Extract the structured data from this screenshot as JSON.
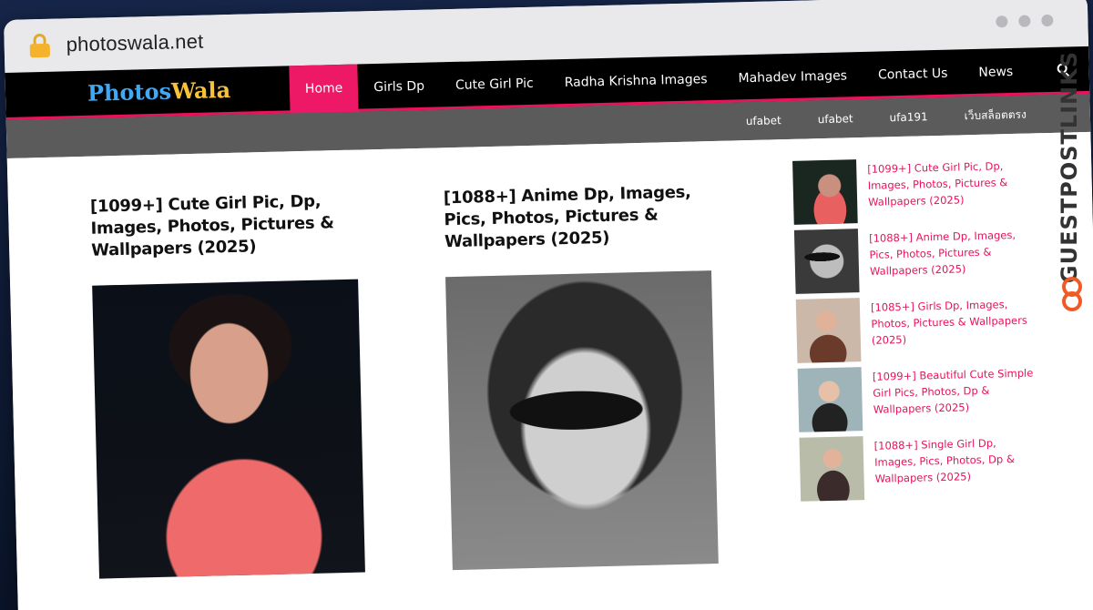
{
  "browser": {
    "url": "photoswala.net"
  },
  "site": {
    "logo": {
      "part1": "Photos",
      "part2": "Wala"
    },
    "menu": [
      {
        "label": "Home",
        "active": true
      },
      {
        "label": "Girls Dp"
      },
      {
        "label": "Cute Girl Pic"
      },
      {
        "label": "Radha Krishna Images"
      },
      {
        "label": "Mahadev Images"
      },
      {
        "label": "Contact Us"
      },
      {
        "label": "News"
      }
    ],
    "submenu": [
      "ufabet",
      "ufabet",
      "ufa191",
      "เว็บสล็อตตรง"
    ],
    "accent_color": "#e8125d"
  },
  "posts": [
    {
      "title": "[1099+] Cute Girl Pic, Dp, Images, Photos, Pictures & Wallpapers (2025)"
    },
    {
      "title": "[1088+] Anime Dp, Images, Pics, Photos, Pictures & Wallpapers (2025)"
    }
  ],
  "sidebar": [
    {
      "title": "[1099+] Cute Girl Pic, Dp, Images, Photos, Pictures & Wallpapers (2025)"
    },
    {
      "title": "[1088+] Anime Dp, Images, Pics, Photos, Pictures & Wallpapers (2025)"
    },
    {
      "title": "[1085+] Girls Dp, Images, Photos, Pictures & Wallpapers (2025)"
    },
    {
      "title": "[1099+] Beautiful Cute Simple Girl Pics, Photos, Dp & Wallpapers (2025)"
    },
    {
      "title": "[1088+] Single Girl Dp, Images, Pics, Photos, Dp & Wallpapers (2025)"
    }
  ],
  "watermark": {
    "text": "GUESTPOSTLINKS",
    "icon": "link-icon"
  }
}
